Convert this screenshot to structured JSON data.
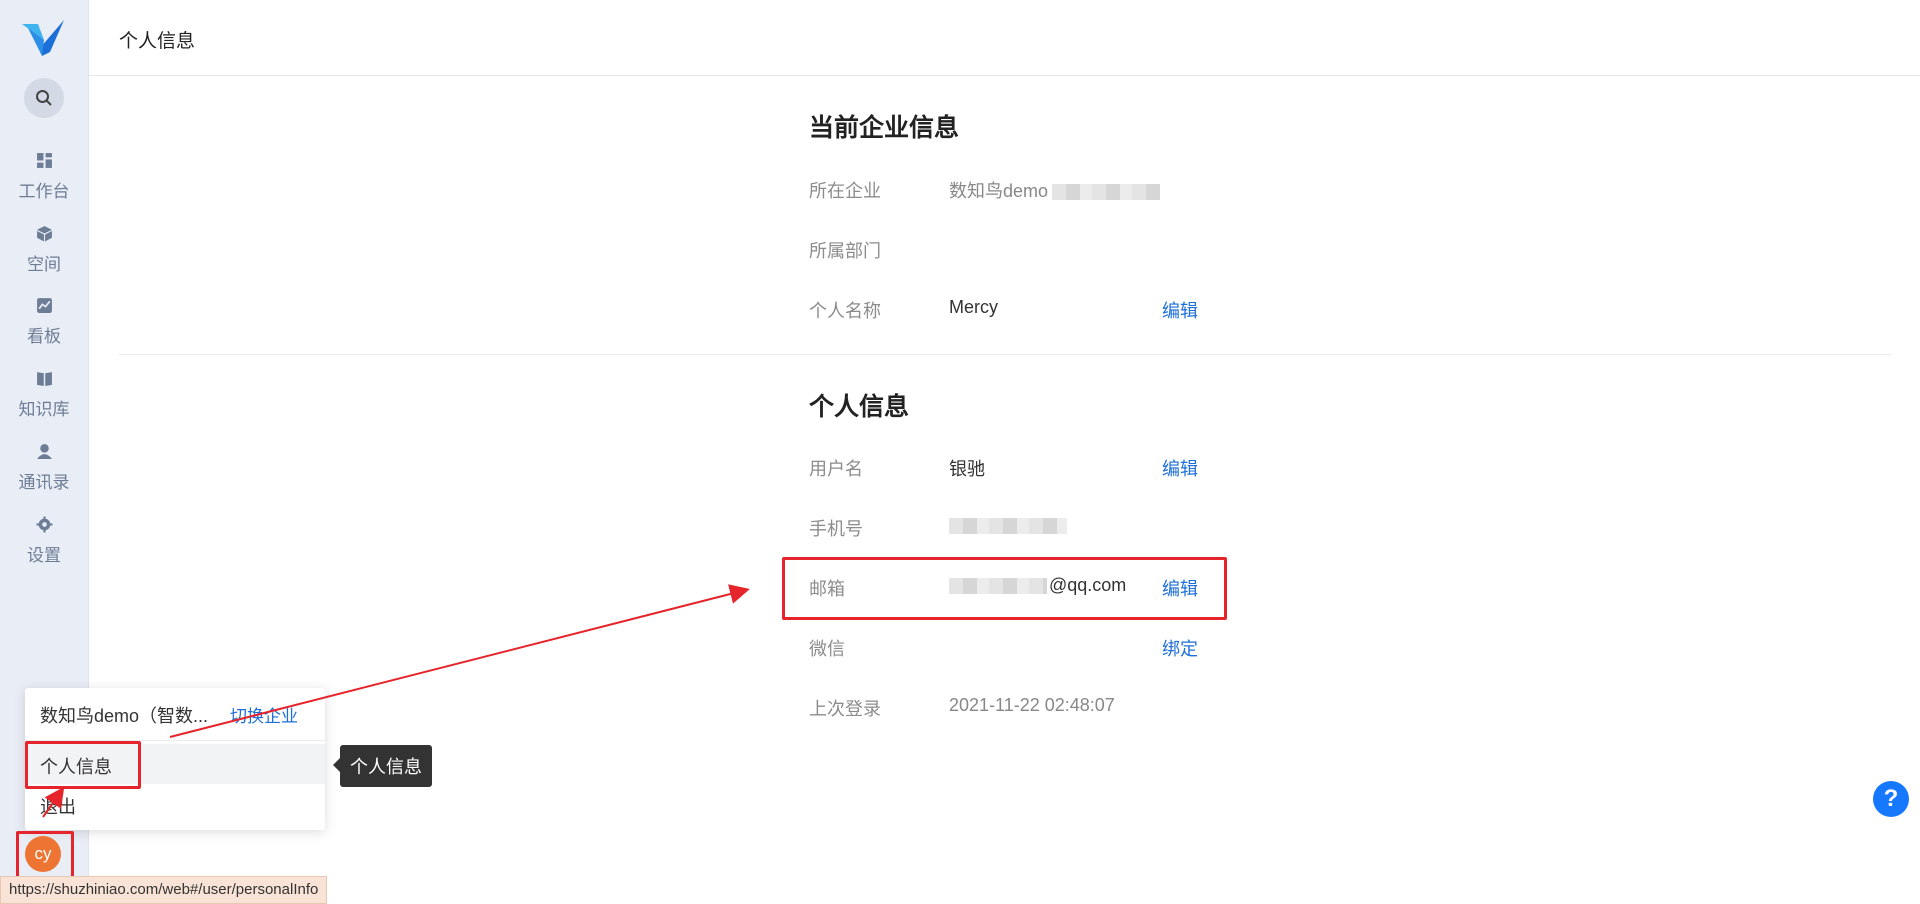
{
  "sidebar": {
    "nav": [
      {
        "label": "工作台",
        "icon": "dashboard-icon"
      },
      {
        "label": "空间",
        "icon": "cube-icon"
      },
      {
        "label": "看板",
        "icon": "chart-icon"
      },
      {
        "label": "知识库",
        "icon": "book-icon"
      },
      {
        "label": "通讯录",
        "icon": "user-icon"
      },
      {
        "label": "设置",
        "icon": "gear-icon"
      }
    ]
  },
  "header": {
    "title": "个人信息"
  },
  "enterprise": {
    "title": "当前企业信息",
    "company_label": "所在企业",
    "company_value": "数知鸟demo",
    "dept_label": "所属部门",
    "name_label": "个人名称",
    "name_value": "Mercy",
    "name_action": "编辑"
  },
  "personal": {
    "title": "个人信息",
    "username_label": "用户名",
    "username_value": "银驰",
    "username_action": "编辑",
    "phone_label": "手机号",
    "email_label": "邮箱",
    "email_value": "@qq.com",
    "email_action": "编辑",
    "wechat_label": "微信",
    "wechat_action": "绑定",
    "lastlogin_label": "上次登录",
    "lastlogin_value": "2021-11-22 02:48:07"
  },
  "popup": {
    "org_name": "数知鸟demo（智数...",
    "switch_label": "切换企业",
    "items": [
      "个人信息",
      "退出"
    ]
  },
  "tooltip": "个人信息",
  "avatar": "cy",
  "status_url": "https://shuzhiniao.com/web#/user/personalInfo",
  "help_icon": "?",
  "colors": {
    "link": "#1e6fd9",
    "annotation": "#e5242b",
    "avatar": "#ee7433"
  }
}
